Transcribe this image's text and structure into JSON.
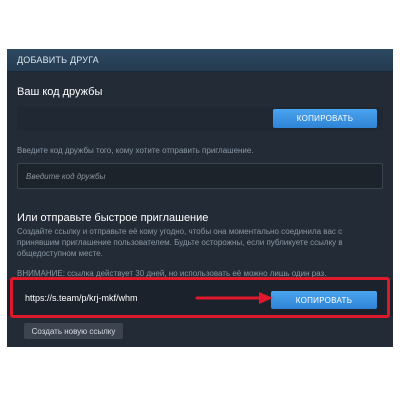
{
  "dialog": {
    "header_title": "ДОБАВИТЬ ДРУГА",
    "friend_code": {
      "title": "Ваш код дружбы",
      "copy_label": "КОПИРОВАТЬ",
      "hint": "Введите код дружбы того, кому хотите отправить приглашение.",
      "input_placeholder": "Введите код дружбы"
    },
    "quick_invite": {
      "title": "Или отправьте быстрое приглашение",
      "description": "Создайте ссылку и отправьте её кому угодно, чтобы она моментально соединила вас с принявшим приглашение пользователем. Будьте осторожны, если публикуете ссылку в общедоступном месте.",
      "warning": "ВНИМАНИЕ: ссылка действует 30 дней, но использовать её можно лишь один раз.",
      "link": "https://s.team/p/krj-mkf/whm",
      "copy_label": "КОПИРОВАТЬ",
      "create_new_label": "Создать новую ссылку"
    }
  },
  "annotation": {
    "highlight_color": "#e0182d",
    "arrow_icon": "arrow-right-icon"
  }
}
